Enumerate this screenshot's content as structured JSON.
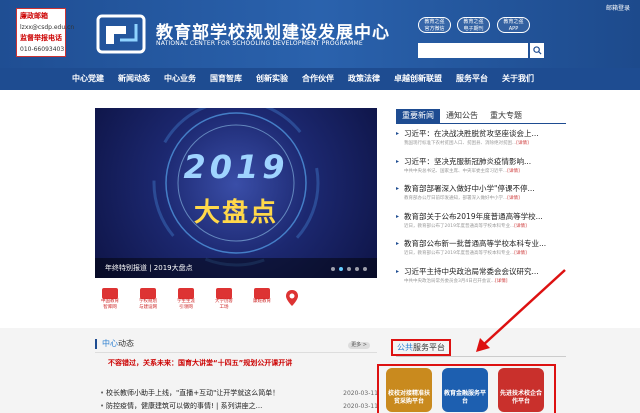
{
  "header": {
    "lianzheng": {
      "line1": "廉政邮箱",
      "line2": "lzxx@csdp.edu.cn",
      "line3": "监督举报电话",
      "line4": "010-66093403"
    },
    "title_cn": "教育部学校规划建设发展中心",
    "title_en": "NATIONAL CENTER FOR SCHOOLING DEVELOPMENT PROGRAMME",
    "mail_link": "邮箱登录",
    "app_buttons": [
      {
        "l1": "教育之强",
        "l2": "官方微信"
      },
      {
        "l1": "教育之强",
        "l2": "电子期刊"
      },
      {
        "l1": "教育之强",
        "l2": "APP"
      }
    ],
    "search_placeholder": ""
  },
  "nav": {
    "items": [
      "中心党建",
      "新闻动态",
      "中心业务",
      "国育智库",
      "创新实验",
      "合作伙伴",
      "政策法律",
      "卓越创新联盟",
      "服务平台",
      "关于我们"
    ]
  },
  "banner": {
    "year": "2019",
    "big": "大盘点",
    "caption": "年终特别报道 | 2019大盘点"
  },
  "quick_links": [
    {
      "a": "中国教育",
      "b": "智库网"
    },
    {
      "a": "学校规划",
      "b": "与建设网"
    },
    {
      "a": "学生生涯",
      "b": "引领网"
    },
    {
      "a": "大学创客",
      "b": "工场"
    },
    {
      "a": "康妮教育",
      "b": ""
    }
  ],
  "tabs": [
    "重要新闻",
    "通知公告",
    "重大专题"
  ],
  "news": [
    {
      "title": "习近平：在决战决胜脱贫攻坚座谈会上...",
      "desc": "我国现行标准下农村贫困人口、贫困县、消除绝对贫困...",
      "more": "[详情]"
    },
    {
      "title": "习近平：坚决克服新冠肺炎疫情影响...",
      "desc": "中共中央总书记、国家主席、中央军委主席习近平...",
      "more": "[详情]"
    },
    {
      "title": "教育部部署深入做好中小学\"停课不停...",
      "desc": "教育部办公厅日前印发通知，部署深入做好中小学...",
      "more": "[详情]"
    },
    {
      "title": "教育部关于公布2019年度普通高等学校...",
      "desc": "近日，教育部公布了2019年度普通高等学校本科专业...",
      "more": "[详情]"
    },
    {
      "title": "教育部公布新一批普通高等学校本科专业...",
      "desc": "近日，教育部公布了2019年度普通高等学校本科专业...",
      "more": "[详情]"
    },
    {
      "title": "习近平主持中央政治局常委会会议研究...",
      "desc": "中共中央政治局常务委员会3月4日召开会议...",
      "more": "[详情]"
    }
  ],
  "center": {
    "title_a": "中心",
    "title_b": "动态",
    "more": "更多 >",
    "headline": "不容错过，关系未来：国育大讲堂“十四五”规划公开课开讲",
    "items": [
      {
        "text": "校长教师小助手上线，\"直播+互动\"让开学就这么简单！",
        "date": "2020-03-11"
      },
      {
        "text": "防控疫情，健康建筑可以做的事情! | 系列讲座之...",
        "date": "2020-03-11"
      }
    ]
  },
  "platform": {
    "title_a": "公共",
    "title_b": "服务平台",
    "buttons": [
      {
        "text": "校校对接精准扶贫采购平台",
        "color": "#c98a1e"
      },
      {
        "text": "教育金融服务平台",
        "color": "#1d5fb0"
      },
      {
        "text": "先进技术校企合作平台",
        "color": "#c9302c"
      }
    ]
  }
}
